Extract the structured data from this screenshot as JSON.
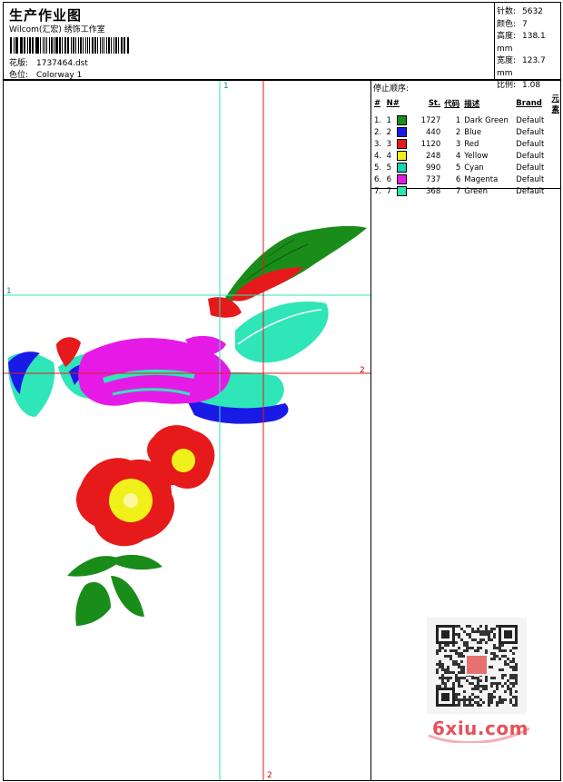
{
  "header": {
    "title": "生产作业图",
    "company": "Wilcom(汇宏) 绣饰工作室",
    "design_label": "花版:",
    "design_value": "1737464.dst",
    "colorway_label": "色位:",
    "colorway_value": "Colorway 1"
  },
  "specs": [
    {
      "label": "针数:",
      "value": "5632"
    },
    {
      "label": "颜色:",
      "value": "7"
    },
    {
      "label": "高度:",
      "value": "138.1 mm"
    },
    {
      "label": "宽度:",
      "value": "123.7 mm"
    },
    {
      "label": "比例:",
      "value": "1.08"
    }
  ],
  "stop_sequence": {
    "label": "停止顺序:",
    "headers": [
      "#",
      "N#",
      "St.",
      "代码",
      "描述",
      "Brand",
      "元素"
    ],
    "rows": [
      {
        "num": "1.",
        "n": "1",
        "color": "#1a8c1a",
        "st": "1727",
        "code": "1",
        "desc": "Dark Green",
        "brand": "Default"
      },
      {
        "num": "2.",
        "n": "2",
        "color": "#1a1ae6",
        "st": "440",
        "code": "2",
        "desc": "Blue",
        "brand": "Default"
      },
      {
        "num": "3.",
        "n": "3",
        "color": "#e61a1a",
        "st": "1120",
        "code": "3",
        "desc": "Red",
        "brand": "Default"
      },
      {
        "num": "4.",
        "n": "4",
        "color": "#f0f01a",
        "st": "248",
        "code": "4",
        "desc": "Yellow",
        "brand": "Default"
      },
      {
        "num": "5.",
        "n": "5",
        "color": "#1ad2b4",
        "st": "990",
        "code": "5",
        "desc": "Cyan",
        "brand": "Default"
      },
      {
        "num": "6.",
        "n": "6",
        "color": "#e61ae6",
        "st": "737",
        "code": "6",
        "desc": "Magenta",
        "brand": "Default"
      },
      {
        "num": "7.",
        "n": "7",
        "color": "#28e6b4",
        "st": "368",
        "code": "7",
        "desc": "Green",
        "brand": "Default"
      }
    ]
  },
  "guides": {
    "green_v": "1",
    "green_h": "1",
    "red_v": "2",
    "red_h": "2"
  },
  "watermark": {
    "site": "6xiu.com"
  }
}
